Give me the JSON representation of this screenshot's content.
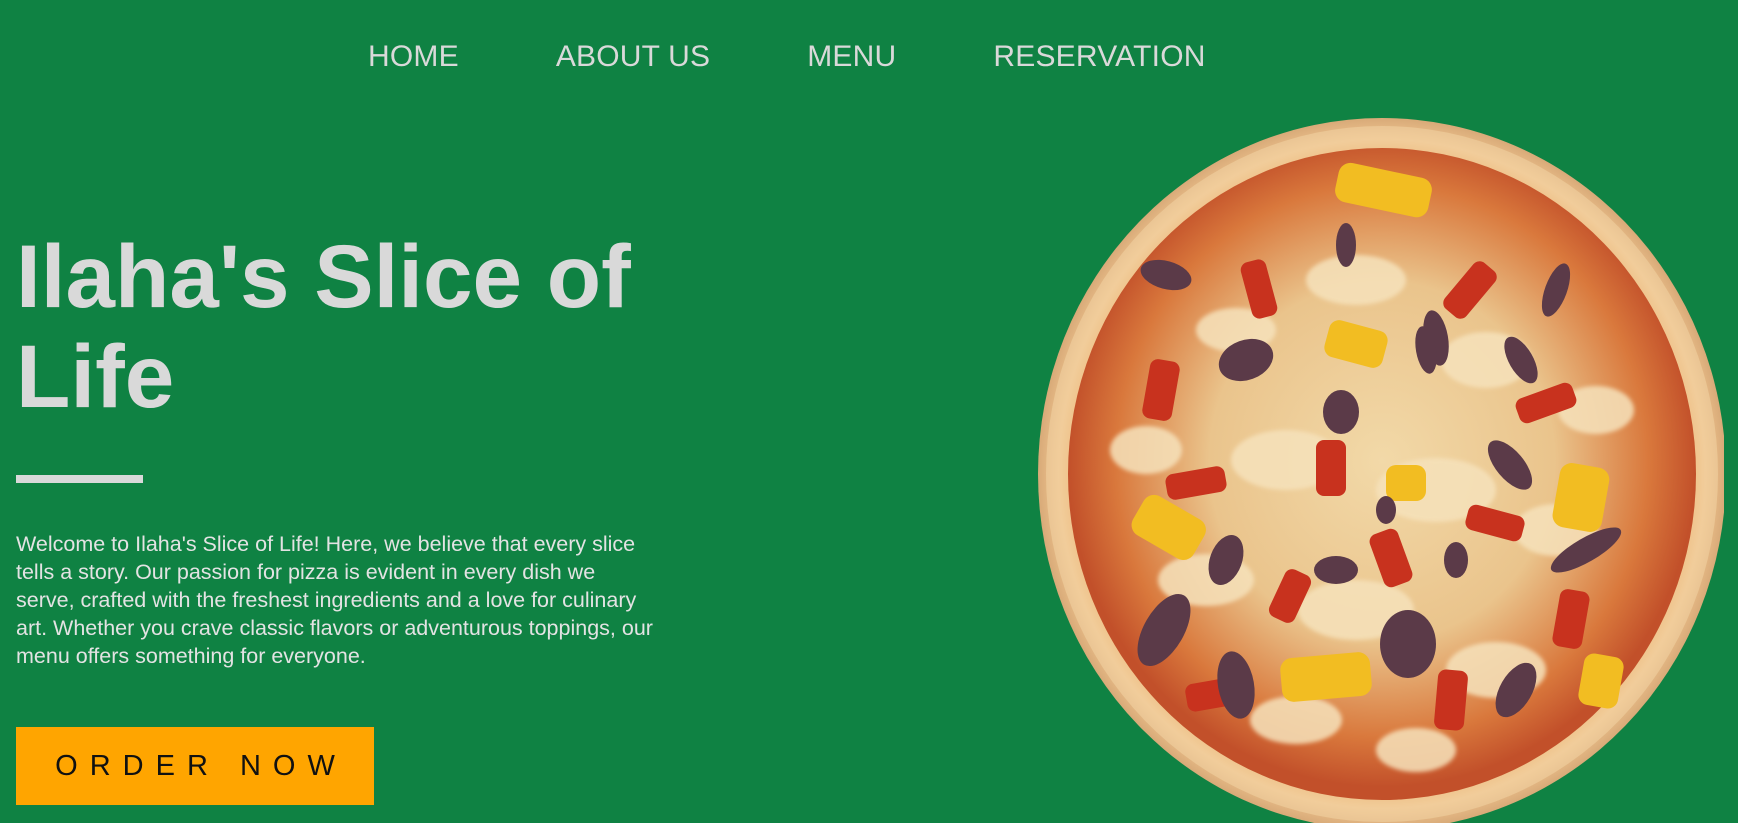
{
  "nav": {
    "items": [
      {
        "label": "HOME"
      },
      {
        "label": "ABOUT US"
      },
      {
        "label": "MENU"
      },
      {
        "label": "RESERVATION"
      }
    ]
  },
  "hero": {
    "title": "Ilaha's Slice of Life",
    "description": "Welcome to Ilaha's Slice of Life! Here, we believe that every slice tells a story. Our passion for pizza is evident in every dish we serve, crafted with the freshest ingredients and a love for culinary art. Whether you crave classic flavors or adventurous toppings, our menu offers something for everyone.",
    "cta_label": "ORDER NOW"
  },
  "colors": {
    "background": "#0f8243",
    "text": "#d9d9d9",
    "accent": "#ffa500"
  },
  "images": {
    "hero_image": "pizza-image"
  }
}
